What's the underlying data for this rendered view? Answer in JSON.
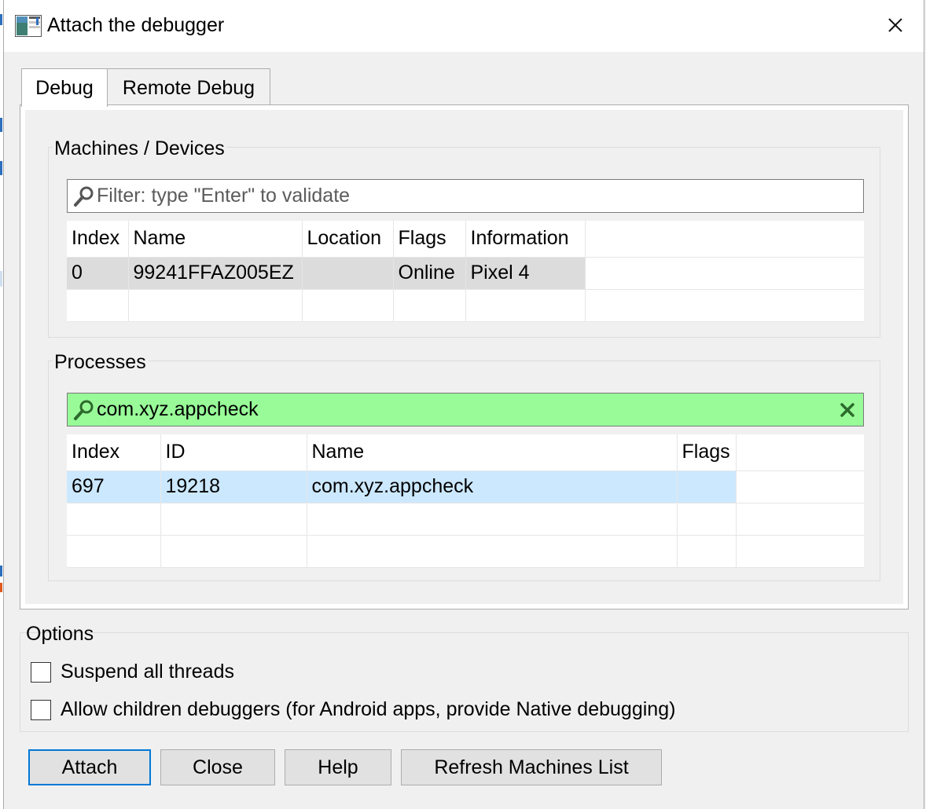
{
  "window": {
    "title": "Attach the debugger"
  },
  "tabs": [
    {
      "label": "Debug",
      "active": true
    },
    {
      "label": "Remote Debug",
      "active": false
    }
  ],
  "machines": {
    "group_label": "Machines / Devices",
    "filter_placeholder": "Filter: type \"Enter\" to validate",
    "filter_value": "",
    "columns": [
      "Index",
      "Name",
      "Location",
      "Flags",
      "Information"
    ],
    "rows": [
      {
        "index": "0",
        "name": "99241FFAZ005EZ",
        "location": "",
        "flags": "Online",
        "information": "Pixel 4",
        "selected": true
      }
    ]
  },
  "processes": {
    "group_label": "Processes",
    "filter_value": "com.xyz.appcheck",
    "filter_bg": "#98fb98",
    "columns": [
      "Index",
      "ID",
      "Name",
      "Flags"
    ],
    "rows": [
      {
        "index": "697",
        "id": "19218",
        "name": "com.xyz.appcheck",
        "flags": "",
        "selected": true
      }
    ]
  },
  "options": {
    "label": "Options",
    "suspend_all_threads": {
      "label": "Suspend all threads",
      "checked": false
    },
    "allow_children": {
      "label": "Allow children debuggers (for Android apps, provide Native debugging)",
      "checked": false
    }
  },
  "buttons": {
    "attach": "Attach",
    "close": "Close",
    "help": "Help",
    "refresh": "Refresh Machines List"
  },
  "colors": {
    "selection_gray": "#dcdcdc",
    "selection_blue": "#cce8ff",
    "accent": "#0078d7",
    "filter_match": "#98fb98"
  },
  "icons": {
    "app": "debugger-window-icon",
    "close": "close-icon",
    "search": "magnifier-icon",
    "clear": "clear-x-icon"
  }
}
